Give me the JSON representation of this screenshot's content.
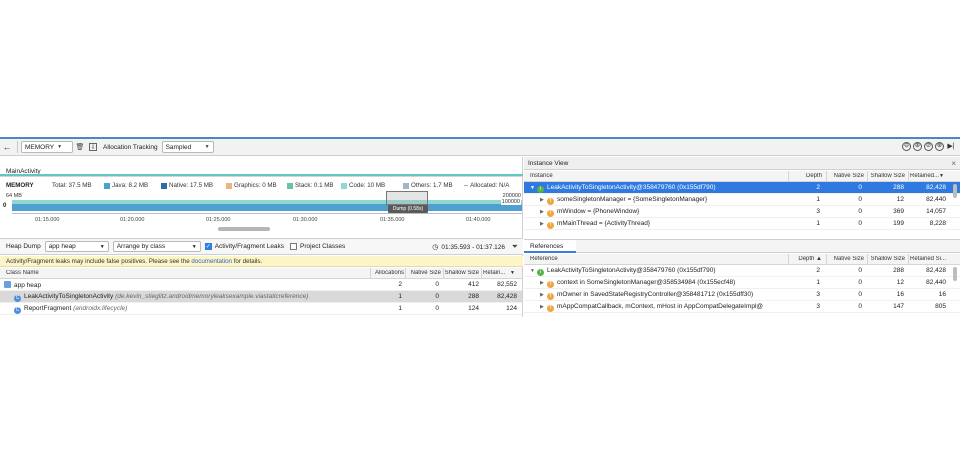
{
  "toolbar": {
    "back_icon": "←",
    "memory_label": "MEMORY",
    "trash_icon": "🗑",
    "export_icon": "⇩",
    "allocation_tracking_label": "Allocation Tracking",
    "allocation_tracking_value": "Sampled",
    "right_icons": [
      "⊖",
      "⊕",
      "⊘",
      "⊗",
      "▶|"
    ]
  },
  "activity": {
    "name": "MainActivity",
    "accent_color": "#5fc8c2"
  },
  "legend": {
    "title": "MEMORY",
    "total": "Total: 37.5 MB",
    "java": "Java: 8.2 MB",
    "native": "Native: 17.5 MB",
    "graphics": "Graphics: 0 MB",
    "stack": "Stack: 0.1 MB",
    "code": "Code: 10 MB",
    "others": "Others: 1.7 MB",
    "allocated": "Allocated: N/A",
    "colors": {
      "java": "#4f9fd1",
      "native": "#2c6e9e",
      "graphics": "#f0b47a",
      "stack": "#67c59f",
      "code": "#8fd7d1",
      "others": "#9fb6c9"
    }
  },
  "timeline": {
    "y_top": "64 MB",
    "right_top": "200000",
    "right_bottom": "100000",
    "marker": "0",
    "dump_label": "Dump (0.58s)",
    "ticks": [
      "01:15.000",
      "01:20.000",
      "01:25.000",
      "01:30.000",
      "01:35.000",
      "01:40.000"
    ]
  },
  "heap": {
    "dump_label": "Heap Dump",
    "heap_select": "app heap",
    "arrange_select": "Arrange by class",
    "leaks_label": "Activity/Fragment Leaks",
    "project_label": "Project Classes",
    "clock_icon": "◷",
    "range": "01:35.593 - 01:37.126",
    "filter_icon": "⏷",
    "check_mark": "✓"
  },
  "warning": {
    "text_before": "Activity/Fragment leaks may include false positives. Please see the ",
    "link": "documentation",
    "text_after": " for details."
  },
  "class_table": {
    "headers": [
      "Class Name",
      "Allocations",
      "Native Size",
      "Shallow Size",
      "Retain..."
    ],
    "sort_icon": "▼",
    "rows": [
      {
        "name": "app heap",
        "pkg": "",
        "alloc": "2",
        "native": "0",
        "shallow": "412",
        "retained": "82,552"
      },
      {
        "name": "LeakActivityToSingletonActivity",
        "pkg": "(de.kevin_stieglitz.androidmemoryleaksexample.viastaticreference)",
        "alloc": "1",
        "native": "0",
        "shallow": "288",
        "retained": "82,428"
      },
      {
        "name": "ReportFragment",
        "pkg": "(androidx.lifecycle)",
        "alloc": "1",
        "native": "0",
        "shallow": "124",
        "retained": "124"
      }
    ]
  },
  "instance_view": {
    "title": "Instance View",
    "close_icon": "×",
    "headers": [
      "Instance",
      "Depth",
      "Native Size",
      "Shallow Size",
      "Retained..."
    ],
    "rows": [
      {
        "name": "LeakActivityToSingletonActivity@358479760 (0x155df790)",
        "depth": "2",
        "native": "0",
        "shallow": "288",
        "retained": "82,428"
      },
      {
        "name": "someSingletonManager = {SomeSingletonManager}",
        "depth": "1",
        "native": "0",
        "shallow": "12",
        "retained": "82,440"
      },
      {
        "name": "mWindow = {PhoneWindow}",
        "depth": "3",
        "native": "0",
        "shallow": "369",
        "retained": "14,057"
      },
      {
        "name": "mMainThread = {ActivityThread}",
        "depth": "1",
        "native": "0",
        "shallow": "199",
        "retained": "8,228"
      }
    ]
  },
  "references": {
    "tab": "References",
    "headers": [
      "Reference",
      "Depth ▲",
      "Native Size",
      "Shallow Size",
      "Retained Si..."
    ],
    "rows": [
      {
        "name": "LeakActivityToSingletonActivity@358479760 (0x155df790)",
        "depth": "2",
        "native": "0",
        "shallow": "288",
        "retained": "82,428"
      },
      {
        "name": "context in SomeSingletonManager@358534984 (0x155ecf48)",
        "depth": "1",
        "native": "0",
        "shallow": "12",
        "retained": "82,440"
      },
      {
        "name": "mOwner in SavedStateRegistryController@358481712 (0x155dff30)",
        "depth": "3",
        "native": "0",
        "shallow": "16",
        "retained": "16"
      },
      {
        "name": "mAppCompatCallback, mContext, mHost in AppCompatDelegateImpl@",
        "depth": "3",
        "native": "0",
        "shallow": "147",
        "retained": "805"
      }
    ]
  }
}
